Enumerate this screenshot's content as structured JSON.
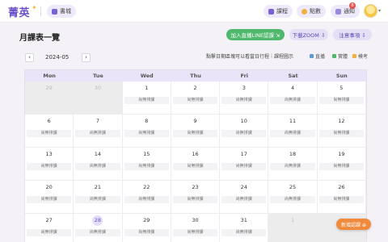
{
  "header": {
    "logo": "菁英",
    "books": "書城",
    "courses": "課程",
    "points": "點數",
    "notifications": "通知",
    "notification_count": "8"
  },
  "page": {
    "title": "月課表一覽",
    "add_line": "加入直播LINE認課 ⇲",
    "download_zoom": "下載ZOOM ⇩",
    "notes": "注意事項 ⇩",
    "month": "2024-05",
    "prev": "‹",
    "next": "›",
    "hint": "點擊日期區塊可以看當日行程｜課程圖示",
    "legend": {
      "live": "直播",
      "recorded": "實體",
      "exam": "模考"
    },
    "add_course": "新增認課 ⊕"
  },
  "calendar": {
    "weekdays": [
      "Mon",
      "Tue",
      "Wed",
      "Thu",
      "Fri",
      "Sat",
      "Sun"
    ],
    "no_class": "尚無排課",
    "days": [
      {
        "n": "29",
        "other": true
      },
      {
        "n": "30",
        "other": true
      },
      {
        "n": "1"
      },
      {
        "n": "2"
      },
      {
        "n": "3"
      },
      {
        "n": "4"
      },
      {
        "n": "5"
      },
      {
        "n": "6"
      },
      {
        "n": "7"
      },
      {
        "n": "8"
      },
      {
        "n": "9"
      },
      {
        "n": "10"
      },
      {
        "n": "11"
      },
      {
        "n": "12"
      },
      {
        "n": "13"
      },
      {
        "n": "14"
      },
      {
        "n": "15"
      },
      {
        "n": "16"
      },
      {
        "n": "17"
      },
      {
        "n": "18"
      },
      {
        "n": "19"
      },
      {
        "n": "20"
      },
      {
        "n": "21"
      },
      {
        "n": "22"
      },
      {
        "n": "23"
      },
      {
        "n": "24"
      },
      {
        "n": "25"
      },
      {
        "n": "26"
      },
      {
        "n": "27"
      },
      {
        "n": "28",
        "today": true
      },
      {
        "n": "29"
      },
      {
        "n": "30"
      },
      {
        "n": "31"
      },
      {
        "n": "1",
        "other": true
      },
      {
        "n": "2",
        "other": true
      }
    ]
  }
}
